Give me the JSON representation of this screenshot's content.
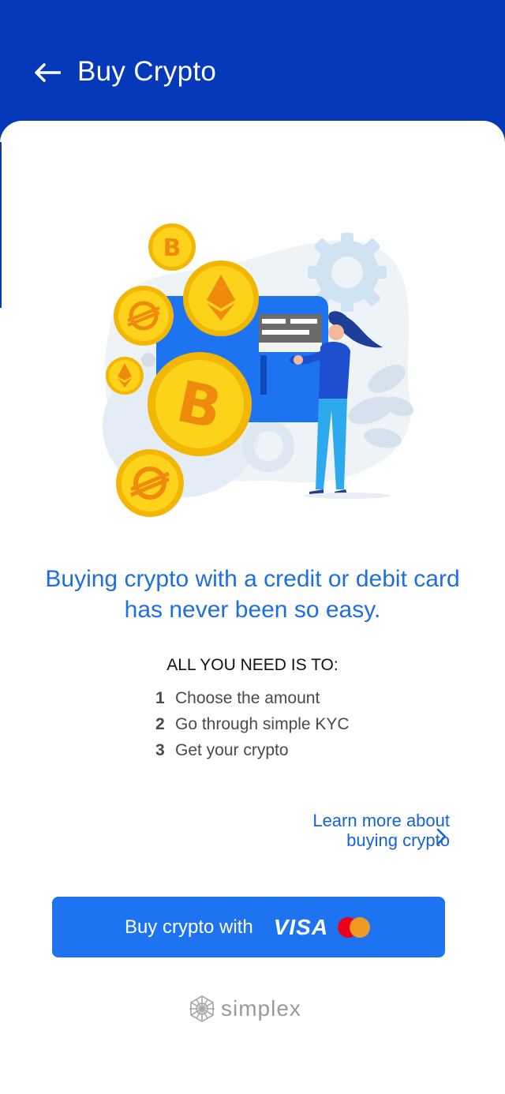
{
  "header": {
    "title": "Buy Crypto",
    "back_icon": "arrow-left-icon",
    "background": "#0639b9"
  },
  "main": {
    "headline": "Buying crypto with a credit or debit card has never been so easy.",
    "requirements_title": "ALL YOU NEED IS TO:",
    "steps": [
      {
        "number": "1",
        "text": "Choose the amount"
      },
      {
        "number": "2",
        "text": "Go through simple KYC"
      },
      {
        "number": "3",
        "text": "Get your crypto"
      }
    ],
    "learn_more": {
      "line1": "Learn more about",
      "line2": "buying crypto",
      "icon": "chevron-right-icon"
    }
  },
  "cta": {
    "label": "Buy crypto with",
    "card_brand": "VISA",
    "second_brand_icon": "mastercard-icon",
    "background": "#1e74f0"
  },
  "footer": {
    "brand": "simplex",
    "icon": "simplex-logo-icon"
  },
  "colors": {
    "accent": "#1d6fe0",
    "coin": "#f7c413",
    "coin_symbol": "#f08a0c"
  }
}
